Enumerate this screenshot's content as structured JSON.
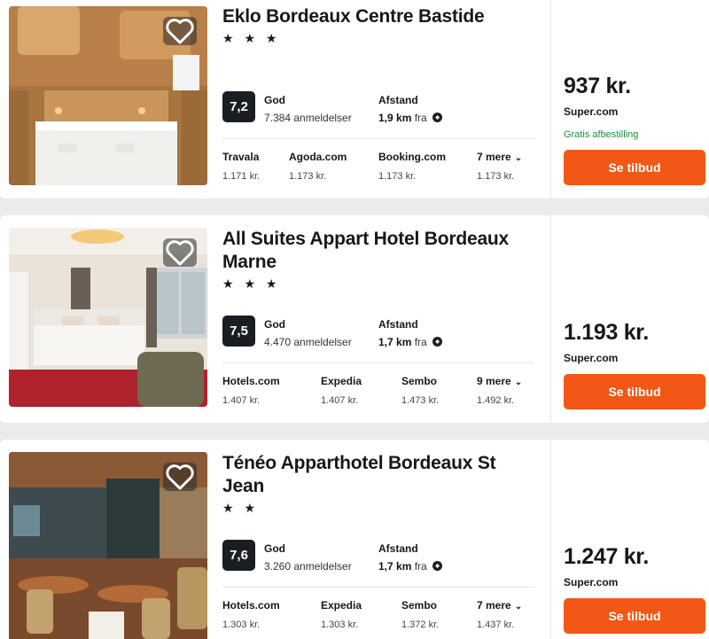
{
  "hotels": [
    {
      "name": "Eklo Bordeaux Centre Bastide",
      "stars": "★ ★ ★",
      "score": "7,2",
      "rating_label": "God",
      "reviews": "7.384 anmeldelser",
      "distance_label": "Afstand",
      "distance": "1,9 km",
      "distance_suffix": "fra",
      "providers": [
        {
          "name": "Travala",
          "price": "1.171 kr."
        },
        {
          "name": "Agoda.com",
          "price": "1.173 kr."
        },
        {
          "name": "Booking.com",
          "price": "1.173 kr."
        },
        {
          "name": "7 mere",
          "price": "1.173 kr."
        }
      ],
      "price": "937 kr.",
      "site": "Super.com",
      "free_cancel": "Gratis afbestilling",
      "cta": "Se tilbud"
    },
    {
      "name": "All Suites Appart Hotel Bordeaux Marne",
      "stars": "★ ★ ★",
      "score": "7,5",
      "rating_label": "God",
      "reviews": "4.470 anmeldelser",
      "distance_label": "Afstand",
      "distance": "1,7 km",
      "distance_suffix": "fra",
      "providers": [
        {
          "name": "Hotels.com",
          "price": "1.407 kr."
        },
        {
          "name": "Expedia",
          "price": "1.407 kr."
        },
        {
          "name": "Sembo",
          "price": "1.473 kr."
        },
        {
          "name": "9 mere",
          "price": "1.492 kr."
        }
      ],
      "price": "1.193 kr.",
      "site": "Super.com",
      "cta": "Se tilbud"
    },
    {
      "name": "Ténéo Apparthotel Bordeaux St Jean",
      "stars": "★ ★",
      "score": "7,6",
      "rating_label": "God",
      "reviews": "3.260 anmeldelser",
      "distance_label": "Afstand",
      "distance": "1,7 km",
      "distance_suffix": "fra",
      "providers": [
        {
          "name": "Hotels.com",
          "price": "1.303 kr."
        },
        {
          "name": "Expedia",
          "price": "1.303 kr."
        },
        {
          "name": "Sembo",
          "price": "1.372 kr."
        },
        {
          "name": "7 mere",
          "price": "1.437 kr."
        }
      ],
      "price": "1.247 kr.",
      "site": "Super.com",
      "cta": "Se tilbud"
    }
  ],
  "icons": {
    "favorite": "heart-icon",
    "location": "location-pin-icon",
    "more": "chevron-down-icon"
  },
  "colors": {
    "cta": "#f25716",
    "score_badge": "#1a1d22",
    "free_cancel": "#1a8f3c"
  }
}
